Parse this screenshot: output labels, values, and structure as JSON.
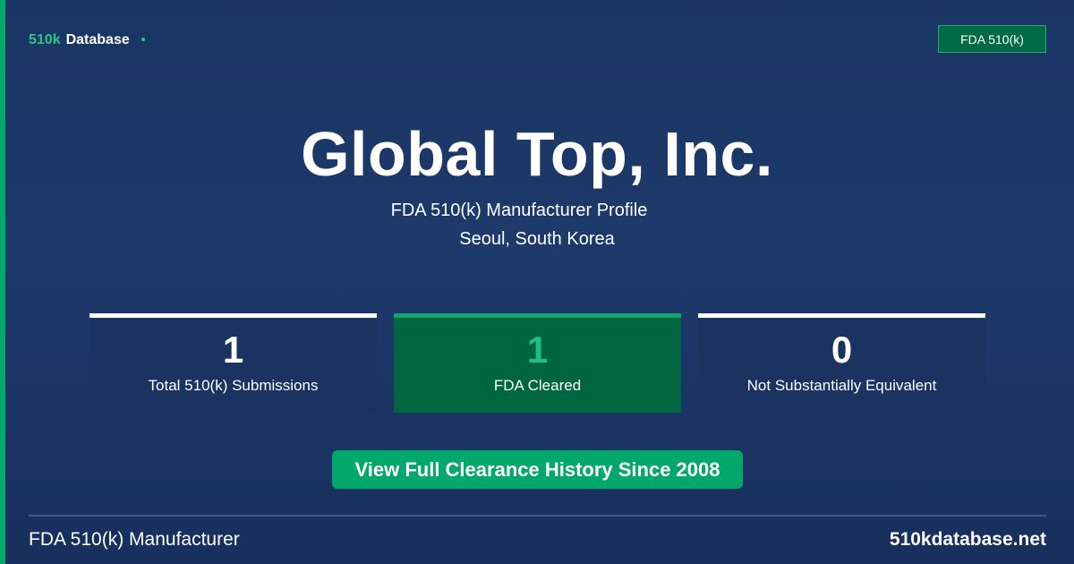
{
  "brand": {
    "name_accent": "510k",
    "name_main": "Database"
  },
  "badge": {
    "label": "FDA 510(k)"
  },
  "profile": {
    "title": "Global Top, Inc.",
    "subtitle": "FDA 510(k) Manufacturer Profile",
    "location": "Seoul, South Korea"
  },
  "stats": [
    {
      "value": "1",
      "label": "Total 510(k) Submissions"
    },
    {
      "value": "1",
      "label": "FDA Cleared"
    },
    {
      "value": "0",
      "label": "Not Substantially Equivalent"
    }
  ],
  "cta": {
    "label": "View Full Clearance History Since 2008"
  },
  "footer": {
    "left": "FDA 510(k) Manufacturer",
    "right": "510kdatabase.net"
  },
  "colors": {
    "accent": "#00a86b",
    "background": "#1d3a6b",
    "cleared_card": "#006642"
  }
}
